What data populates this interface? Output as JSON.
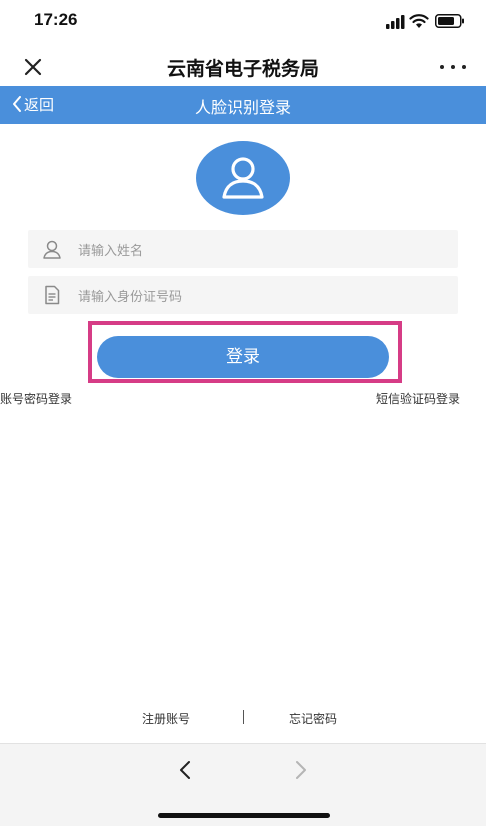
{
  "status_bar": {
    "time": "17:26"
  },
  "title_bar": {
    "title": "云南省电子税务局"
  },
  "nav_bar": {
    "back_label": "返回",
    "title": "人脸识别登录"
  },
  "form": {
    "name_placeholder": "请输入姓名",
    "id_placeholder": "请输入身份证号码",
    "login_label": "登录"
  },
  "links": {
    "password_login": "账号密码登录",
    "sms_login": "短信验证码登录"
  },
  "footer": {
    "register": "注册账号",
    "separator": "|",
    "forgot_password": "忘记密码"
  },
  "colors": {
    "accent": "#4a8fdb",
    "highlight": "#d63c86"
  }
}
